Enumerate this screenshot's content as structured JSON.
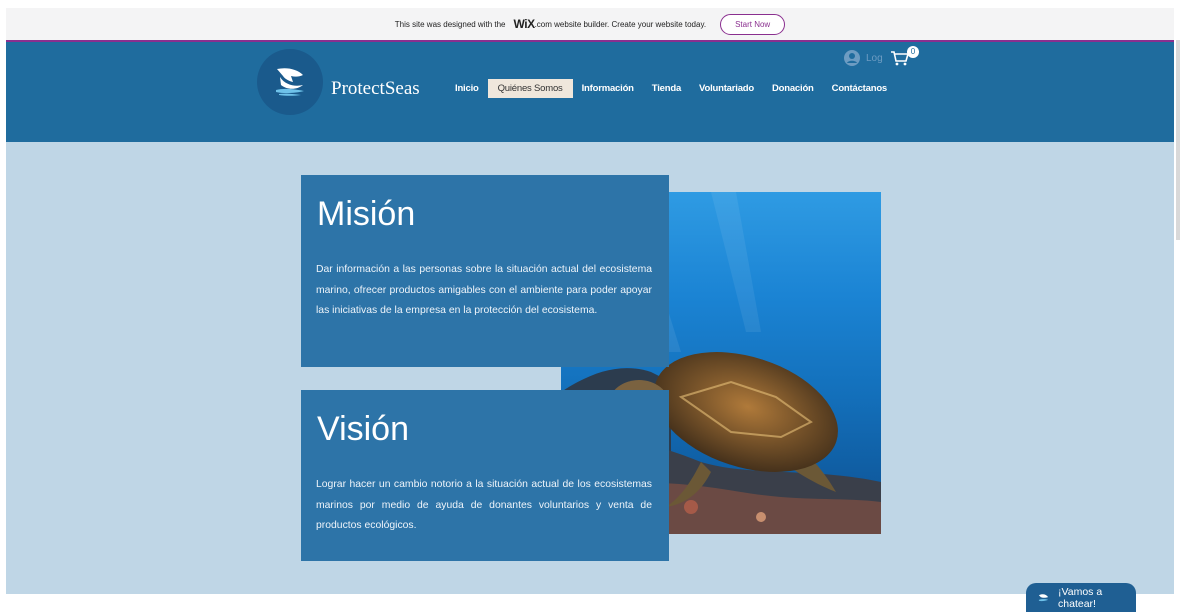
{
  "banner": {
    "prefix": "This site was designed with the",
    "wix_logo": "WiX",
    "suffix": ".com website builder. Create your website today.",
    "start_label": "Start Now"
  },
  "header": {
    "brand": "ProtectSeas",
    "login_label": "Log",
    "cart_count": "0",
    "nav": [
      {
        "label": "Inicio",
        "active": false
      },
      {
        "label": "Quiénes Somos",
        "active": true
      },
      {
        "label": "Información",
        "active": false
      },
      {
        "label": "Tienda",
        "active": false
      },
      {
        "label": "Voluntariado",
        "active": false
      },
      {
        "label": "Donación",
        "active": false
      },
      {
        "label": "Contáctanos",
        "active": false
      }
    ]
  },
  "mision": {
    "title": "Misión",
    "text": "Dar información a las personas sobre la situación actual del ecosistema marino, ofrecer productos amigables con el ambiente para poder apoyar las iniciativas de la empresa en la protección del ecosistema."
  },
  "vision": {
    "title": "Visión",
    "text": "Lograr hacer un cambio notorio a la situación actual de los ecosistemas marinos por medio de ayuda de donantes voluntarios y venta de productos ecológicos."
  },
  "chat": {
    "label": "¡Vamos a chatear!"
  },
  "colors": {
    "header": "#1f6c9e",
    "background": "#bfd6e6",
    "card": "#2d74a8",
    "wix_accent": "#8a2f8f"
  }
}
